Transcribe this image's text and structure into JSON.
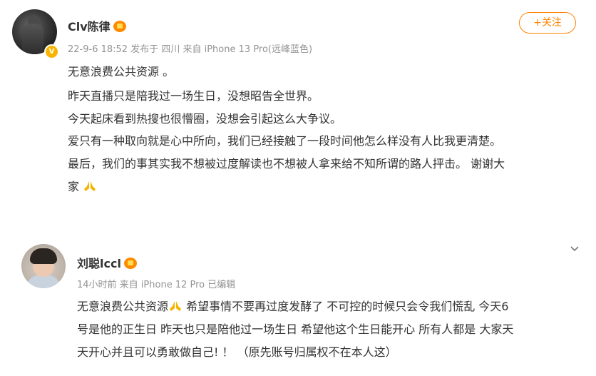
{
  "post": {
    "author": "Clv陈律",
    "meta": "22-9-6 18:52 发布于 四川  来自 iPhone 13 Pro(远峰蓝色)",
    "follow_label": "+关注",
    "lines": [
      "无意浪费公共资源 。",
      "昨天直播只是陪我过一场生日，没想昭告全世界。",
      "今天起床看到热搜也很懵圈，没想会引起这么大争议。",
      "爱只有一种取向就是心中所向，我们已经接触了一段时间他怎么样没有人比我更清楚。",
      "最后，我们的事其实我不想被过度解读也不想被人拿来给不知所谓的路人抨击。 谢谢大",
      "家"
    ]
  },
  "comment": {
    "author": "刘聪lccl",
    "meta": "14小时前  来自 iPhone 12 Pro  已编辑",
    "lines": [
      [
        "无意浪费公共资源",
        " 希望事情不要再过度发酵了 不可控的时候只会令我们慌乱 今天6"
      ],
      "号是他的正生日 昨天也只是陪他过一场生日 希望他这个生日能开心 所有人都是 大家天",
      "天开心并且可以勇敢做自己! ！ （原先账号归属权不在本人这）"
    ]
  },
  "icons": {
    "verified": "verified-v-icon",
    "member": "member-crown-icon",
    "pray": "pray-hands-icon",
    "expand": "chevron-down-icon"
  },
  "colors": {
    "accent": "#ff8200",
    "meta_text": "#939393",
    "verified": "#f7b500"
  }
}
